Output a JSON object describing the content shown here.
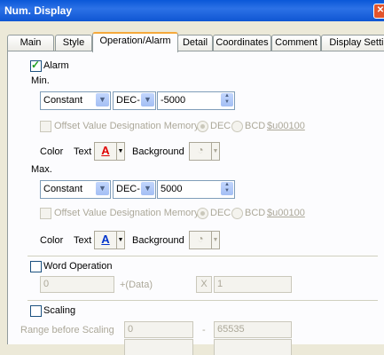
{
  "window": {
    "title": "Num. Display",
    "close": "✕"
  },
  "tabs": [
    {
      "label": "Main",
      "active": false
    },
    {
      "label": "Style",
      "active": false
    },
    {
      "label": "Operation/Alarm",
      "active": true
    },
    {
      "label": "Detail",
      "active": false
    },
    {
      "label": "Coordinates",
      "active": false
    },
    {
      "label": "Comment",
      "active": false
    },
    {
      "label": "Display Setting",
      "active": false
    }
  ],
  "alarm": {
    "label": "Alarm",
    "checked": true,
    "min": {
      "label": "Min.",
      "type": "Constant",
      "format": "DEC-",
      "value": "-5000",
      "offset_label": "Offset Value Designation Memory",
      "dec": "DEC",
      "bcd": "BCD",
      "device": "$u00100",
      "color_label": "Color",
      "text_label": "Text",
      "text_glyph": "A",
      "text_color": "#e00000",
      "bg_label": "Background"
    },
    "max": {
      "label": "Max.",
      "type": "Constant",
      "format": "DEC-",
      "value": "5000",
      "offset_label": "Offset Value Designation Memory",
      "dec": "DEC",
      "bcd": "BCD",
      "device": "$u00100",
      "color_label": "Color",
      "text_label": "Text",
      "text_glyph": "A",
      "text_color": "#0033cc",
      "bg_label": "Background"
    }
  },
  "word_operation": {
    "label": "Word Operation",
    "value": "0",
    "data_label": "+(Data)",
    "op_symbol": "X",
    "factor": "1"
  },
  "scaling": {
    "label": "Scaling",
    "range_label": "Range before Scaling",
    "from": "0",
    "dash": "-",
    "to": "65535"
  }
}
